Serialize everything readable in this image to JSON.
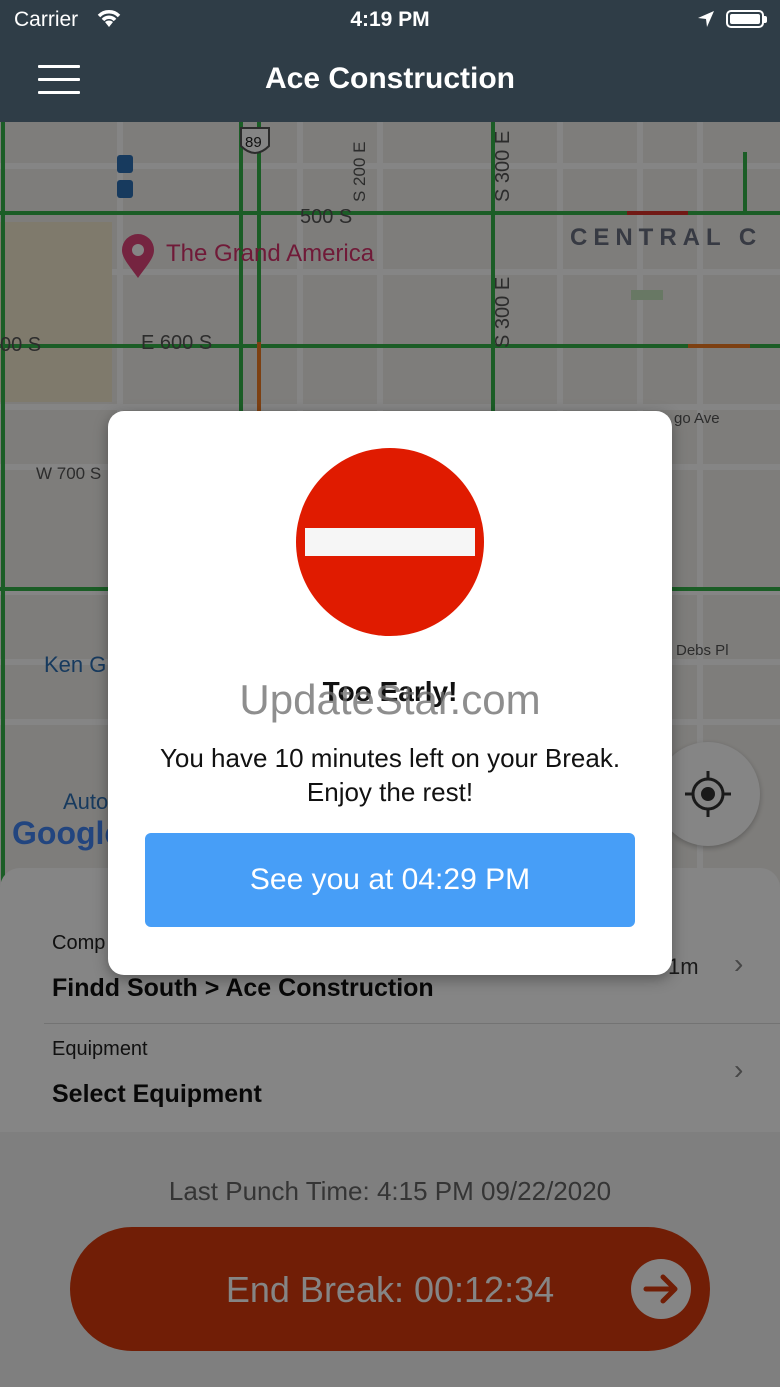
{
  "status_bar": {
    "carrier": "Carrier",
    "time": "4:19 PM"
  },
  "header": {
    "title": "Ace Construction"
  },
  "map": {
    "poi": "The Grand America",
    "district": "CENTRAL C",
    "streets": [
      "500 S",
      "E 600 S",
      "00 S",
      "W 700 S",
      "S 200 E",
      "S 300 E",
      "S 300 E",
      "go Ave",
      "Debs Pl"
    ],
    "route_shield": "89",
    "place_partial": "Ken G",
    "place_partial_2": "Auto",
    "logo": "Google"
  },
  "sheet": {
    "company": {
      "label": "Comp",
      "value": "Findd South > Ace Construction",
      "distance": "1m"
    },
    "equipment": {
      "label": "Equipment",
      "value": "Select Equipment"
    },
    "last_punch": "Last Punch Time: 4:15 PM 09/22/2020",
    "end_break_label": "End Break: 00:12:34"
  },
  "modal": {
    "title": "Too Early!",
    "message": "You have 10 minutes left on your Break. Enjoy the rest!",
    "button_label": "See you at 04:29 PM"
  },
  "watermark": "UpdateStar.com",
  "colors": {
    "header": "#2f3d47",
    "stop_sign": "#e01b00",
    "modal_button": "#479ef7",
    "end_break": "#d83a0c",
    "poi": "#d6336c"
  }
}
